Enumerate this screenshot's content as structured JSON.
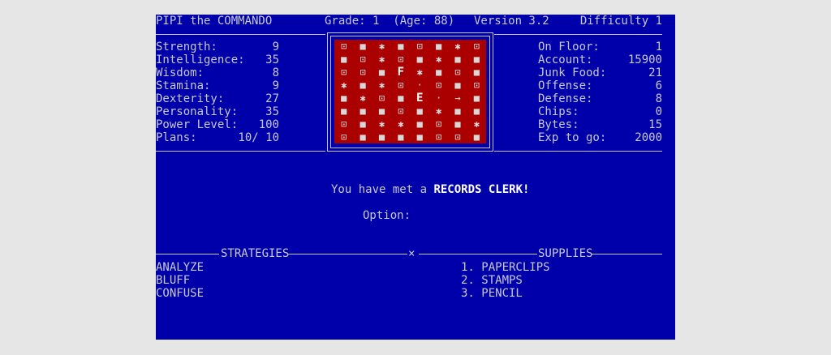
{
  "header": {
    "title": "PIPI the COMMANDO",
    "grade": "Grade: 1  (Age: 88)",
    "version": "Version 3.2",
    "difficulty": "Difficulty 1"
  },
  "left_stats": [
    {
      "label": "Strength:",
      "value": "9"
    },
    {
      "label": "Intelligence:",
      "value": "35"
    },
    {
      "label": "Wisdom:",
      "value": "8"
    },
    {
      "label": "Stamina:",
      "value": "9"
    },
    {
      "label": "Dexterity:",
      "value": "27"
    },
    {
      "label": "Personality:",
      "value": "35"
    },
    {
      "label": "Power Level:",
      "value": "100"
    },
    {
      "label": "Plans:",
      "value": "10/ 10"
    }
  ],
  "right_stats": [
    {
      "label": "On Floor:",
      "value": "1"
    },
    {
      "label": "Account:",
      "value": "15900"
    },
    {
      "label": "Junk Food:",
      "value": "21"
    },
    {
      "label": "Offense:",
      "value": "6"
    },
    {
      "label": "Defense:",
      "value": "8"
    },
    {
      "label": "Chips:",
      "value": "0"
    },
    {
      "label": "Bytes:",
      "value": "15"
    },
    {
      "label": "Exp to go:",
      "value": "2000"
    }
  ],
  "maze": [
    [
      "⊡",
      "■",
      "✱",
      "■",
      "⊡",
      "■",
      "✱",
      "⊡"
    ],
    [
      "■",
      "⊡",
      "✱",
      "⊡",
      "■",
      "✱",
      "■",
      "■"
    ],
    [
      "⊡",
      "⊡",
      "■",
      "F",
      "✱",
      "■",
      "⊡",
      "■"
    ],
    [
      "✱",
      "■",
      "✱",
      "⊡",
      "·",
      "⊡",
      "■",
      "⊡"
    ],
    [
      "■",
      "✱",
      "⊡",
      "■",
      "E",
      "·",
      "→",
      "■"
    ],
    [
      "■",
      "■",
      "■",
      "⊡",
      "■",
      "✱",
      "■",
      "■"
    ],
    [
      "⊡",
      "■",
      "✱",
      "✱",
      "■",
      "⊡",
      "■",
      "✱"
    ],
    [
      "⊡",
      "■",
      "■",
      "■",
      "■",
      "⊡",
      "⊡",
      "■"
    ]
  ],
  "message": {
    "prefix": "You have met a ",
    "name": "RECORDS CLERK!",
    "option_label": "Option:"
  },
  "strategies": {
    "heading": "STRATEGIES",
    "items": [
      "ANALYZE",
      "BLUFF",
      "CONFUSE"
    ]
  },
  "divider_mark": "×",
  "supplies": {
    "heading": "SUPPLIES",
    "items": [
      "1. PAPERCLIPS",
      "2. STAMPS",
      "3. PENCIL"
    ]
  }
}
